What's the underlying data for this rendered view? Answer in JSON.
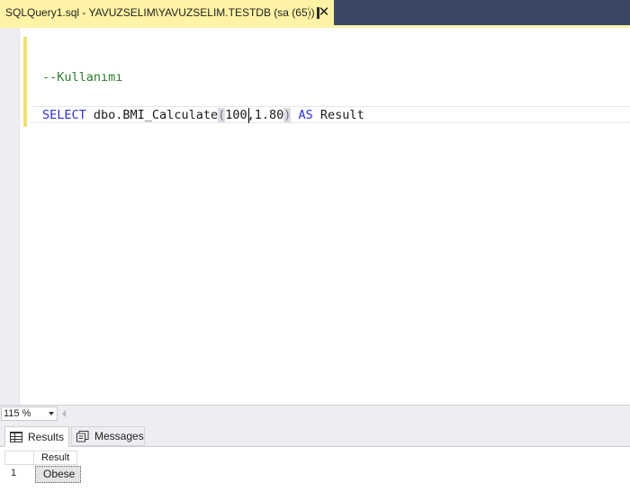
{
  "tab": {
    "title": "SQLQuery1.sql - YAVUZSELIM\\YAVUZSELIM.TESTDB (sa (65))",
    "close_label": "✕"
  },
  "editor": {
    "comment_line": "--Kullanımı",
    "statement": {
      "kw_select": "SELECT",
      "text_func": " dbo.BMI_Calculate",
      "open_paren": "(",
      "args": "100,1.80",
      "close_paren": ")",
      "kw_as": " AS",
      "text_alias": " Result"
    }
  },
  "zoom": {
    "value": "115 %"
  },
  "results": {
    "tabs": [
      {
        "label": "Results",
        "icon": "grid-icon"
      },
      {
        "label": "Messages",
        "icon": "messages-icon"
      }
    ],
    "grid": {
      "columns": [
        "Result"
      ],
      "rows": [
        {
          "rownum": "1",
          "cells": [
            "Obese"
          ]
        }
      ]
    }
  }
}
